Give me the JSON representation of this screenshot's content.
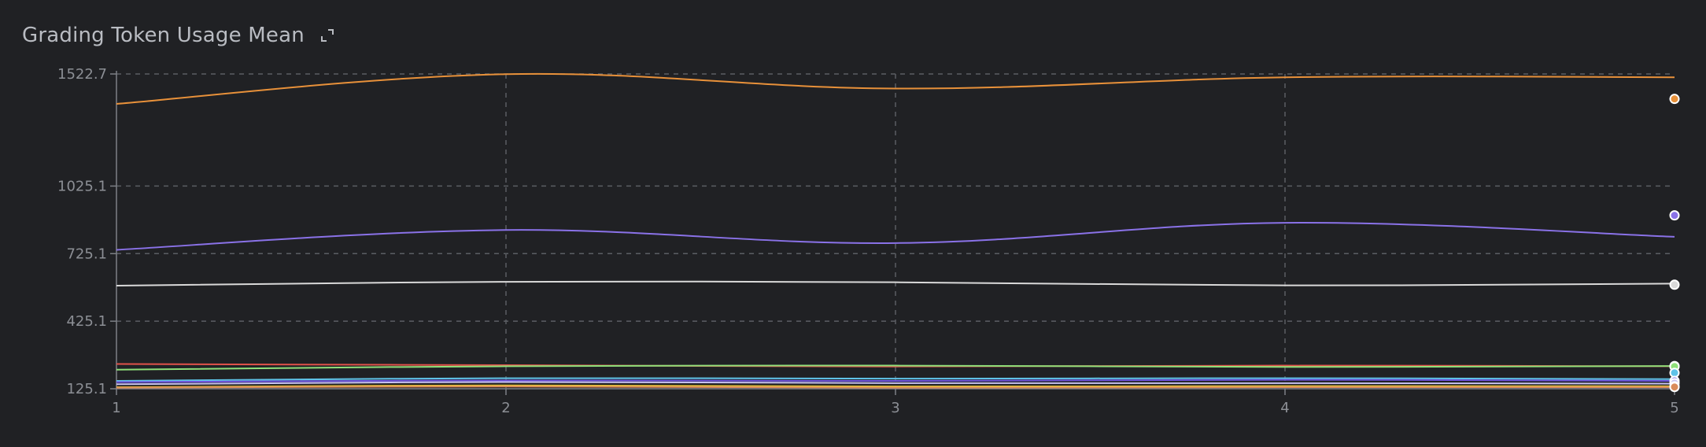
{
  "panel": {
    "title": "Grading Token Usage Mean",
    "expand_icon": "expand-icon"
  },
  "colors": {
    "background": "#202124",
    "grid": "#5b5e63",
    "axis": "#7d8086",
    "tick_text": "#8c8f95"
  },
  "chart_data": {
    "type": "line",
    "title": "Grading Token Usage Mean",
    "xlabel": "",
    "ylabel": "",
    "x": [
      1,
      2,
      3,
      4,
      5
    ],
    "xlim": [
      1,
      5
    ],
    "ylim": [
      125.1,
      1522.7
    ],
    "x_ticks": [
      "1",
      "2",
      "3",
      "4",
      "5"
    ],
    "y_ticks": [
      "125.1",
      "425.1",
      "725.1",
      "1025.1",
      "1522.7"
    ],
    "y_tick_values": [
      125.1,
      425.1,
      725.1,
      1025.1,
      1522.7
    ],
    "grid": true,
    "legend": "none",
    "series": [
      {
        "color": "#e8913a",
        "values": [
          1390,
          1522,
          1458,
          1508,
          1508
        ],
        "end_marker": 1412
      },
      {
        "color": "#8a72e8",
        "values": [
          742,
          830,
          772,
          862,
          800
        ],
        "end_marker": 895
      },
      {
        "color": "#d9d9d9",
        "values": [
          583,
          600,
          598,
          584,
          592
        ],
        "end_marker": 587
      },
      {
        "color": "#e0524a",
        "values": [
          235,
          230,
          224,
          228,
          225
        ],
        "end_marker": 226
      },
      {
        "color": "#8fe07a",
        "values": [
          210,
          225,
          228,
          222,
          226
        ],
        "end_marker": 224
      },
      {
        "color": "#5fc3e8",
        "values": [
          160,
          172,
          170,
          172,
          168
        ],
        "end_marker": 196
      },
      {
        "color": "#6f55e0",
        "values": [
          155,
          162,
          160,
          165,
          160
        ],
        "end_marker": 160
      },
      {
        "color": "#c7c2f0",
        "values": [
          145,
          155,
          150,
          150,
          148
        ],
        "end_marker": 150
      },
      {
        "color": "#e8c53a",
        "values": [
          132,
          140,
          135,
          137,
          136
        ],
        "end_marker": 136
      },
      {
        "color": "#d98c5a",
        "values": [
          130,
          135,
          130,
          132,
          132
        ],
        "end_marker": 133
      }
    ]
  }
}
